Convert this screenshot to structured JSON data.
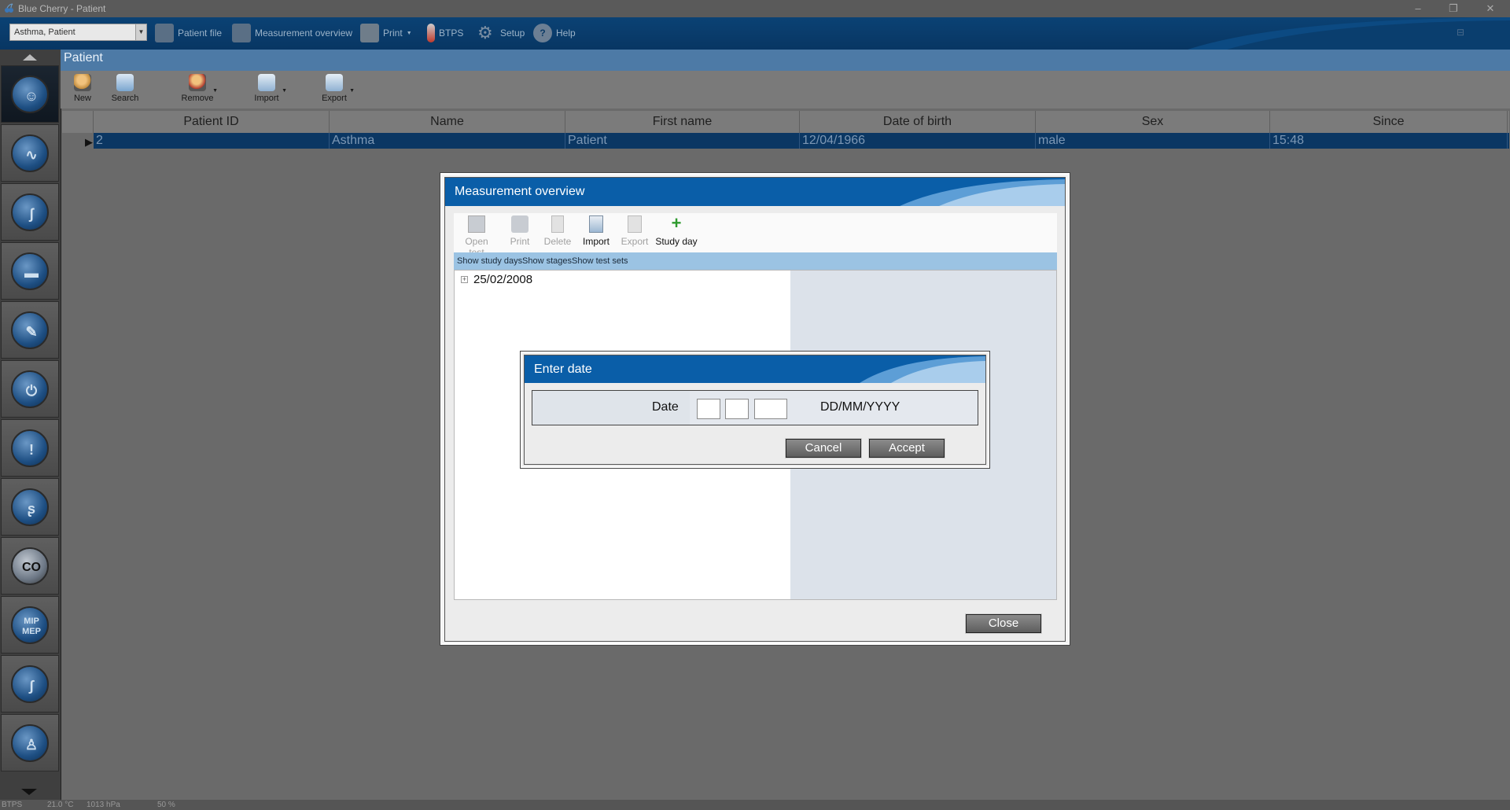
{
  "window": {
    "title": "Blue Cherry - Patient"
  },
  "toolbar": {
    "patient_select": "Asthma, Patient",
    "patient_file": "Patient file",
    "measurement_overview": "Measurement overview",
    "print": "Print",
    "btps": "BTPS",
    "setup": "Setup",
    "help": "Help"
  },
  "panel": {
    "title": "Patient",
    "tools": {
      "new": "New",
      "search": "Search",
      "remove": "Remove",
      "import": "Import",
      "export": "Export"
    }
  },
  "grid": {
    "columns": [
      "Patient ID",
      "Name",
      "First name",
      "Date of birth",
      "Sex",
      "Since"
    ],
    "rows": [
      {
        "patient_id": "2",
        "name": "Asthma",
        "first_name": "Patient",
        "dob": "12/04/1966",
        "sex": "male",
        "since": "15:48"
      }
    ]
  },
  "measurement_overview": {
    "title": "Measurement overview",
    "tools": {
      "open_test": "Open test",
      "print": "Print",
      "delete": "Delete",
      "import": "Import",
      "export": "Export",
      "study_day": "Study day"
    },
    "links": {
      "show_study_days": "Show study days",
      "show_stages": "Show stages",
      "show_test_sets": "Show test sets"
    },
    "tree": [
      {
        "label": "25/02/2008",
        "expander": "+"
      }
    ],
    "close_label": "Close"
  },
  "enter_date": {
    "title": "Enter date",
    "date_label": "Date",
    "day_value": "",
    "month_value": "",
    "year_value": "",
    "format_hint": "DD/MM/YYYY",
    "cancel_label": "Cancel",
    "accept_label": "Accept"
  },
  "statusbar": {
    "btps": "BTPS",
    "temp": "21.0 °C",
    "pressure": "1013 hPa",
    "humidity": "50 %"
  },
  "colors": {
    "accent": "#0a5ea8",
    "title_bar": "#083663",
    "selected_row": "#0b3763"
  }
}
